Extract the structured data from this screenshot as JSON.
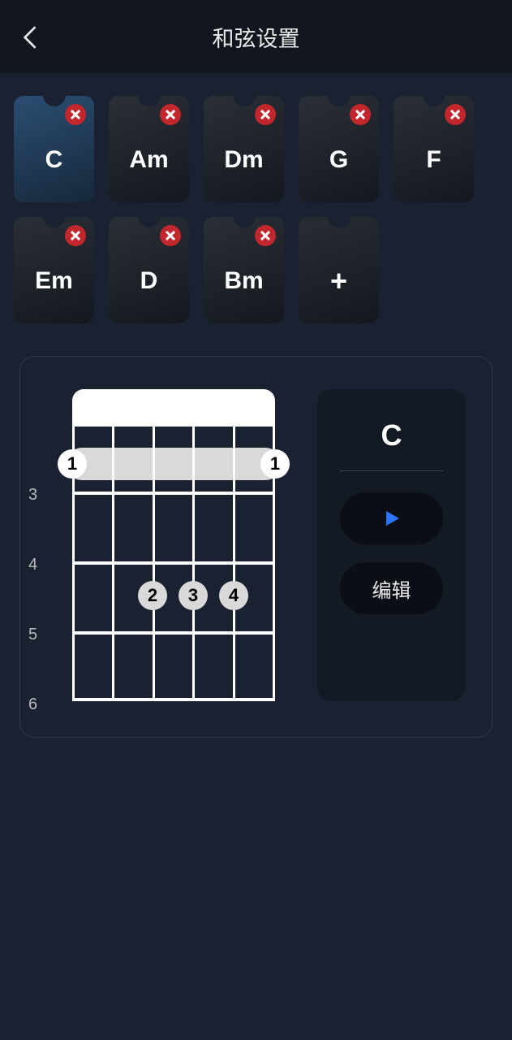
{
  "header": {
    "title": "和弦设置"
  },
  "chords": [
    {
      "label": "C",
      "selected": true,
      "removable": true
    },
    {
      "label": "Am",
      "selected": false,
      "removable": true
    },
    {
      "label": "Dm",
      "selected": false,
      "removable": true
    },
    {
      "label": "G",
      "selected": false,
      "removable": true
    },
    {
      "label": "F",
      "selected": false,
      "removable": true
    },
    {
      "label": "Em",
      "selected": false,
      "removable": true
    },
    {
      "label": "D",
      "selected": false,
      "removable": true
    },
    {
      "label": "Bm",
      "selected": false,
      "removable": true
    }
  ],
  "add_label": "+",
  "detail": {
    "chord_name": "C",
    "fret_start": 3,
    "fret_labels": [
      "3",
      "4",
      "5",
      "6"
    ],
    "barre_fingers": {
      "left": "1",
      "right": "1"
    },
    "fingers": [
      {
        "label": "2",
        "string_index": 2,
        "fret_row": 3
      },
      {
        "label": "3",
        "string_index": 3,
        "fret_row": 3
      },
      {
        "label": "4",
        "string_index": 4,
        "fret_row": 3
      }
    ],
    "edit_label": "编辑"
  }
}
